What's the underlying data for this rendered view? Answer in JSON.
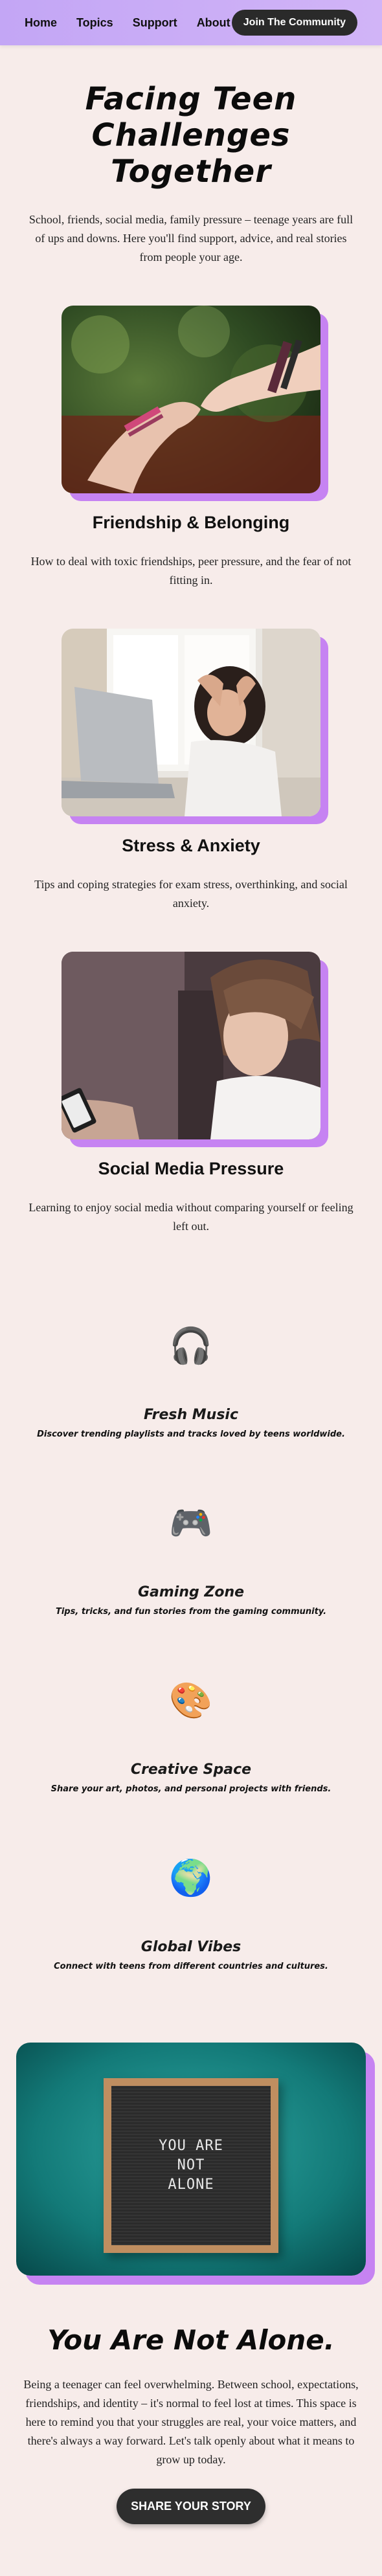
{
  "nav": {
    "links": [
      "Home",
      "Topics",
      "Support",
      "About"
    ],
    "cta_label": "Join The Community"
  },
  "hero": {
    "title_line1": "Facing Teen",
    "title_line2": "Challenges Together",
    "text": "School, friends, social media, family pressure – teenage years are full of ups and downs. Here you'll find support, advice, and real stories from people your age."
  },
  "topics": [
    {
      "title": "Friendship & Belonging",
      "text": "How to deal with toxic friendships, peer pressure, and the fear of not fitting in."
    },
    {
      "title": "Stress & Anxiety",
      "text": "Tips and coping strategies for exam stress, overthinking, and social anxiety."
    },
    {
      "title": "Social Media Pressure",
      "text": "Learning to enjoy social media without comparing yourself or feeling left out."
    }
  ],
  "features": [
    {
      "icon": "headphones-icon",
      "glyph": "🎧",
      "title": "Fresh Music",
      "text": "Discover trending playlists and tracks loved by teens worldwide."
    },
    {
      "icon": "game-controller-icon",
      "glyph": "🎮",
      "title": "Gaming Zone",
      "text": "Tips, tricks, and fun stories from the gaming community."
    },
    {
      "icon": "palette-icon",
      "glyph": "🎨",
      "title": "Creative Space",
      "text": "Share your art, photos, and personal projects with friends."
    },
    {
      "icon": "globe-icon",
      "glyph": "🌍",
      "title": "Global Vibes",
      "text": "Connect with teens from different countries and cultures."
    }
  ],
  "banner": {
    "board_line1": "YOU ARE",
    "board_line2": "NOT",
    "board_line3": "ALONE"
  },
  "closing": {
    "title": "You Are Not Alone.",
    "text": "Being a teenager can feel overwhelming. Between school, expectations, friendships, and identity – it's normal to feel lost at times. This space is here to remind you that your struggles are real, your voice matters, and there's always a way forward. Let's talk openly about what it means to grow up today.",
    "cta_label": "SHARE YOUR STORY"
  },
  "colors": {
    "nav_gradient_start": "#c3a6f5",
    "nav_gradient_end": "#d1b4f7",
    "accent_shadow": "#c683f2",
    "page_background": "#f7ecea",
    "button_dark": "#2a2a2a"
  }
}
